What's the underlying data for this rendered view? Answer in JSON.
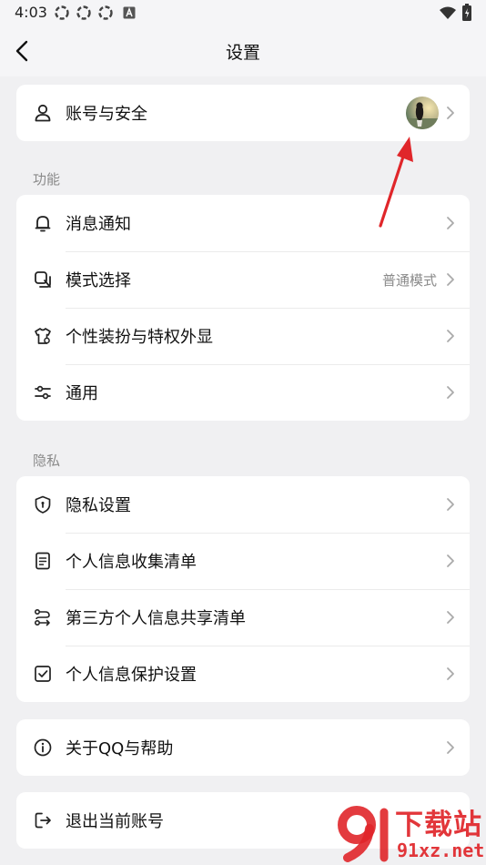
{
  "status_bar": {
    "time": "4:03"
  },
  "nav": {
    "title": "设置"
  },
  "account": {
    "label": "账号与安全"
  },
  "sections": {
    "features": "功能",
    "privacy": "隐私"
  },
  "features": {
    "notifications": "消息通知",
    "mode": "模式选择",
    "mode_value": "普通模式",
    "personalize": "个性装扮与特权外显",
    "general": "通用"
  },
  "privacy": {
    "privacy_settings": "隐私设置",
    "info_collection": "个人信息收集清单",
    "third_party": "第三方个人信息共享清单",
    "protection": "个人信息保护设置"
  },
  "about": {
    "label": "关于QQ与帮助"
  },
  "logout": {
    "label": "退出当前账号"
  },
  "watermark": {
    "brand": "下载站",
    "url": "91xz.net"
  },
  "colors": {
    "annotation_arrow": "#e0262a",
    "watermark": "#e0262a"
  }
}
